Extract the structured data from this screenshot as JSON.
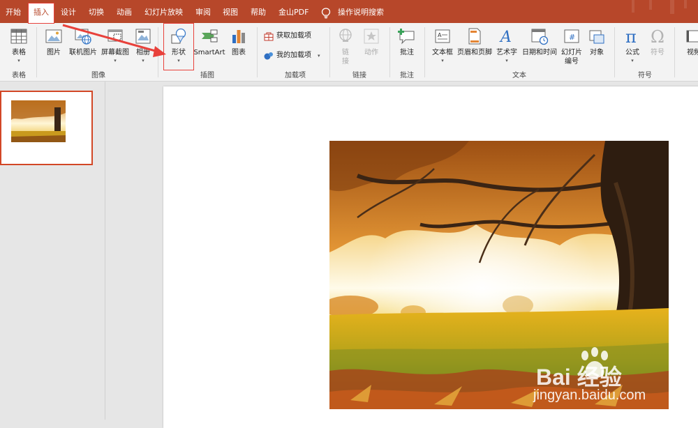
{
  "tabs": [
    {
      "label": "开始"
    },
    {
      "label": "插入"
    },
    {
      "label": "设计"
    },
    {
      "label": "切换"
    },
    {
      "label": "动画"
    },
    {
      "label": "幻灯片放映"
    },
    {
      "label": "审阅"
    },
    {
      "label": "视图"
    },
    {
      "label": "帮助"
    },
    {
      "label": "金山PDF"
    }
  ],
  "tell_me": "操作说明搜索",
  "ribbon": {
    "table": "表格",
    "picture": "图片",
    "online_picture": "联机图片",
    "screenshot": "屏幕截图",
    "album": "相册",
    "shapes": "形状",
    "smartart": "SmartArt",
    "chart": "图表",
    "get_addins": "获取加载项",
    "my_addins": "我的加载项",
    "link_l1": "链",
    "link_l2": "接",
    "action": "动作",
    "comment": "批注",
    "textbox": "文本框",
    "header_footer": "页眉和页脚",
    "wordart": "艺术字",
    "datetime": "日期和时间",
    "slide_number_l1": "幻灯片",
    "slide_number_l2": "编号",
    "object": "对象",
    "equation": "公式",
    "symbol": "符号",
    "video": "视频"
  },
  "groups": {
    "tables": "表格",
    "images": "图像",
    "illustrations": "插图",
    "addins": "加载项",
    "links": "链接",
    "comments": "批注",
    "text": "文本",
    "symbols": "符号"
  },
  "watermark": {
    "logo": "Bai  经验",
    "url": "jingyan.baidu.com"
  },
  "colors": {
    "accent": "#b7472a",
    "annotation": "#e8413b",
    "selection": "#d24726"
  }
}
